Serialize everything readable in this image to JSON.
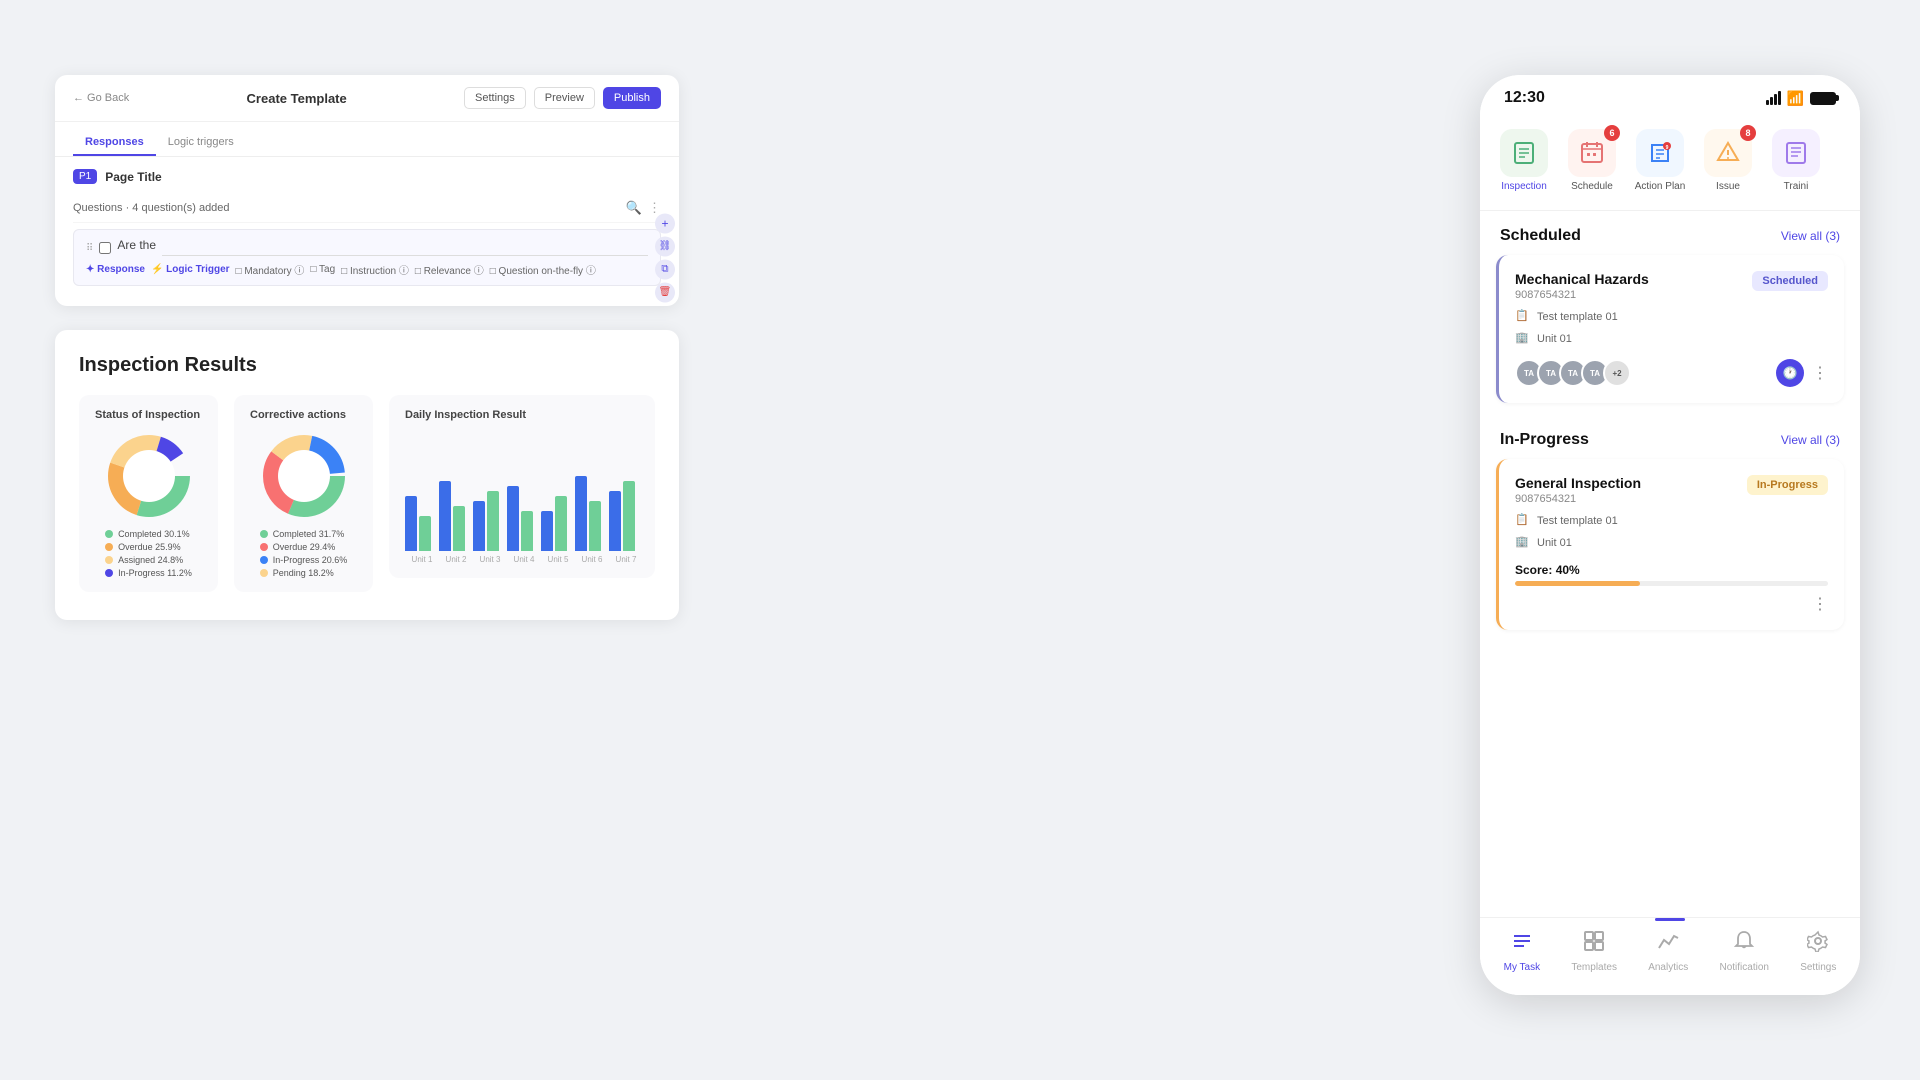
{
  "page": {
    "background": "#f0f2f5"
  },
  "create_template": {
    "back_label": "← Go Back",
    "title": "Create Template",
    "btn_settings": "Settings",
    "btn_preview": "Preview",
    "btn_publish": "Publish",
    "tab_responses": "Responses",
    "tab_logic": "Logic triggers",
    "page_badge": "P1",
    "page_title_label": "Page Title",
    "questions_label": "Questions · 4 question(s) added",
    "question_text": "Are the",
    "tags": [
      "Response",
      "Logic Trigger",
      "Mandatory",
      "Tag",
      "Instruction",
      "Relevance",
      "Question on-the-fly"
    ]
  },
  "inspection_results": {
    "title": "Inspection Results",
    "donut1_title": "Status of Inspection",
    "donut1_segments": [
      {
        "label": "Overdue",
        "pct": "25.9%",
        "color": "#f6ad55"
      },
      {
        "label": "Completed",
        "pct": "30.1%",
        "color": "#6fcf97"
      },
      {
        "label": "Assigned",
        "pct": "24.8%",
        "color": "#fbd38d"
      },
      {
        "label": "In-Progress",
        "pct": "11.2%",
        "color": "#4f46e5"
      }
    ],
    "donut2_title": "Corrective actions",
    "donut2_segments": [
      {
        "label": "Overdue",
        "pct": "29.4%",
        "color": "#f87171"
      },
      {
        "label": "Completed",
        "pct": "31.7%",
        "color": "#6fcf97"
      },
      {
        "label": "Pending",
        "pct": "18.2%",
        "color": "#fbd38d"
      },
      {
        "label": "In-Progress",
        "pct": "20.6%",
        "color": "#3b82f6"
      }
    ],
    "bar_chart_title": "Daily Inspection Result",
    "bar_labels": [
      "Unit 1",
      "Unit 2",
      "Unit 3",
      "Unit 4",
      "Unit 5",
      "Unit 6",
      "Unit 7"
    ],
    "bar_data_blue": [
      55,
      70,
      50,
      65,
      40,
      75,
      60
    ],
    "bar_data_green": [
      35,
      45,
      60,
      40,
      55,
      50,
      70
    ]
  },
  "mobile_app": {
    "time": "12:30",
    "nav_items": [
      {
        "label": "Inspection",
        "icon": "📋",
        "badge": null,
        "active": true
      },
      {
        "label": "Schedule",
        "icon": "📅",
        "badge": "6",
        "active": false
      },
      {
        "label": "Action Plan",
        "icon": "📌",
        "badge": "9",
        "active": false
      },
      {
        "label": "Issue",
        "icon": "🔔",
        "badge": "8",
        "active": false
      },
      {
        "label": "Traini",
        "icon": "📄",
        "badge": null,
        "active": false
      }
    ],
    "scheduled_section": {
      "title": "Scheduled",
      "view_all": "View all (3)",
      "card": {
        "title": "Mechanical Hazards",
        "id": "9087654321",
        "status": "Scheduled",
        "template": "Test template 01",
        "unit": "Unit  01",
        "avatars": [
          "TA",
          "TA",
          "TA",
          "TA",
          "+2"
        ]
      }
    },
    "inprogress_section": {
      "title": "In-Progress",
      "view_all": "View all (3)",
      "card": {
        "title": "General Inspection",
        "id": "9087654321",
        "status": "In-Progress",
        "template": "Test template 01",
        "unit": "Unit  01",
        "score_label": "Score:",
        "score_value": "40%",
        "score_pct": 40
      }
    },
    "bottom_nav": [
      {
        "label": "My Task",
        "icon": "☰",
        "active": true
      },
      {
        "label": "Templates",
        "icon": "⊞",
        "active": false
      },
      {
        "label": "Analytics",
        "icon": "📈",
        "active": false
      },
      {
        "label": "Notification",
        "icon": "🔔",
        "active": false
      },
      {
        "label": "Settings",
        "icon": "⚙",
        "active": false
      }
    ]
  }
}
